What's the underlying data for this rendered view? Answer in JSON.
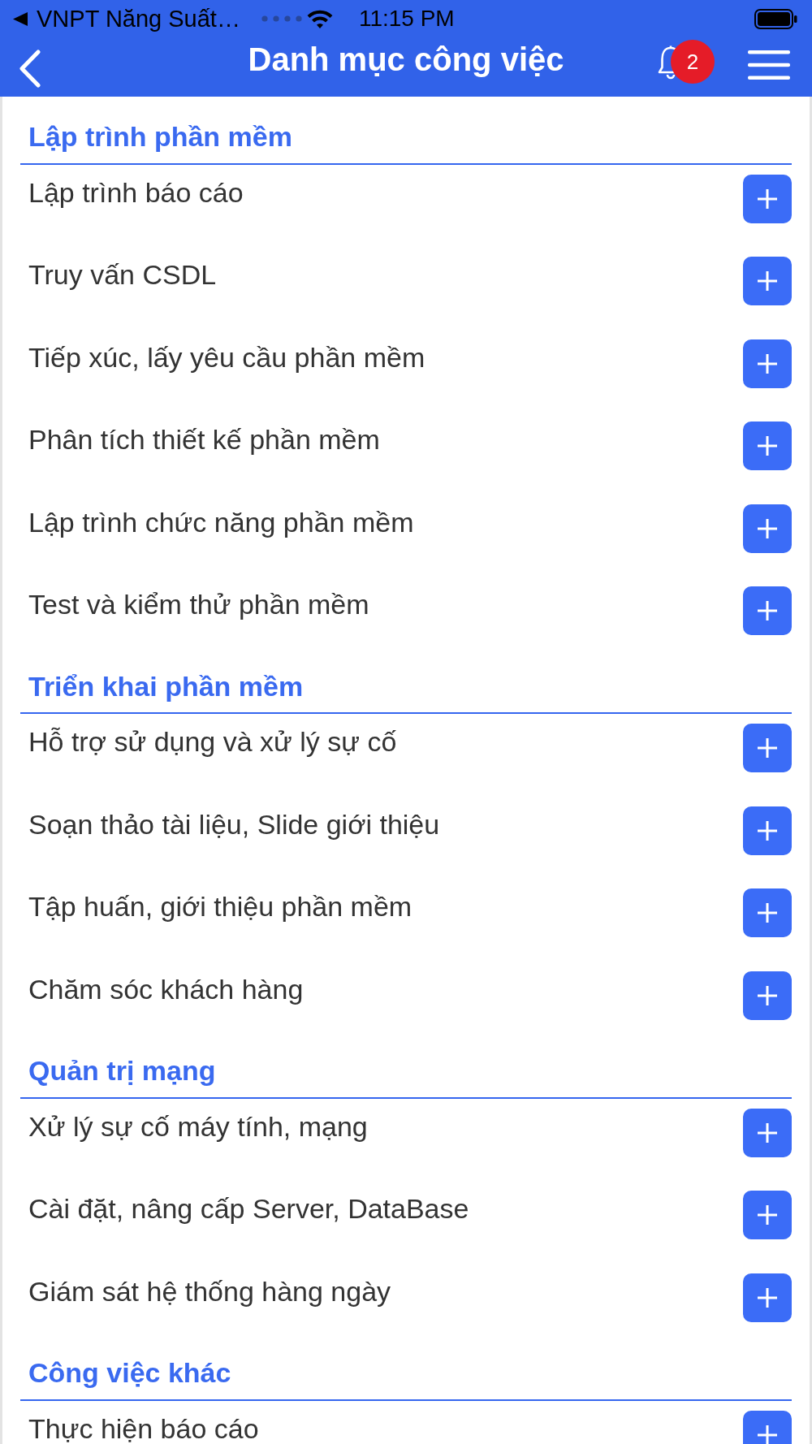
{
  "status_bar": {
    "carrier": "VNPT Năng Suất…",
    "time": "11:15 PM"
  },
  "nav_bar": {
    "title": "Danh mục công việc",
    "notification_badge": "2"
  },
  "sections": [
    {
      "title": "Lập trình phần mềm",
      "items": [
        "Lập trình báo cáo",
        "Truy vấn CSDL",
        "Tiếp xúc, lấy yêu cầu phần mềm",
        "Phân tích thiết kế phần mềm",
        "Lập trình chức năng phần mềm",
        "Test và kiểm thử phần mềm"
      ]
    },
    {
      "title": "Triển khai phần mềm",
      "items": [
        "Hỗ trợ sử dụng và xử lý sự cố",
        "Soạn thảo tài liệu, Slide giới thiệu",
        "Tập huấn, giới thiệu phần mềm",
        "Chăm sóc khách hàng"
      ]
    },
    {
      "title": "Quản trị mạng",
      "items": [
        "Xử lý sự cố máy tính, mạng",
        "Cài đặt, nâng cấp Server, DataBase",
        "Giám sát hệ thống hàng ngày"
      ]
    },
    {
      "title": "Công việc khác",
      "items": [
        "Thực hiện báo cáo"
      ]
    }
  ]
}
